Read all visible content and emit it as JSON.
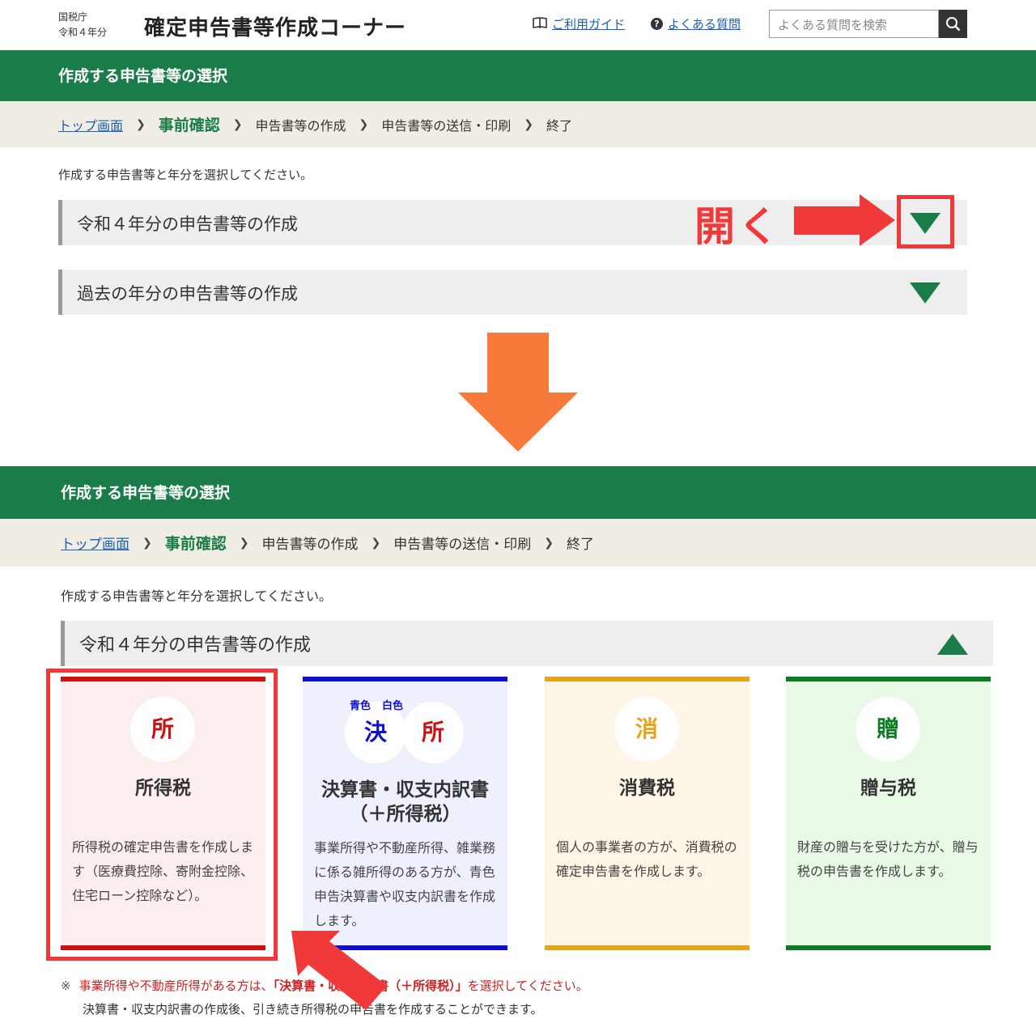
{
  "header": {
    "agency": "国税庁",
    "year": "令和４年分",
    "app_title": "確定申告書等作成コーナー",
    "guide_link": "ご利用ガイド",
    "faq_link": "よくある質問",
    "search_placeholder": "よくある質問を検索"
  },
  "top": {
    "page_title": "作成する申告書等の選択",
    "breadcrumb": [
      "トップ画面",
      "事前確認",
      "申告書等の作成",
      "申告書等の送信・印刷",
      "終了"
    ],
    "instruction": "作成する申告書等と年分を選択してください。",
    "accordion_current": "令和４年分の申告書等の作成",
    "accordion_past": "過去の年分の申告書等の作成",
    "annotation": "開く"
  },
  "bottom": {
    "page_title": "作成する申告書等の選択",
    "breadcrumb": [
      "トップ画面",
      "事前確認",
      "申告書等の作成",
      "申告書等の送信・印刷",
      "終了"
    ],
    "instruction": "作成する申告書等と年分を選択してください。",
    "accordion_current": "令和４年分の申告書等の作成",
    "cards": [
      {
        "icon_char": "所",
        "title": "所得税",
        "desc": "所得税の確定申告書を作成します（医療費控除、寄附金控除、住宅ローン控除など）。"
      },
      {
        "icon_char_1": "決",
        "icon_char_2": "所",
        "tag_blue": "青色",
        "tag_white": "白色",
        "title_1": "決算書・収支内訳書",
        "title_2": "（＋所得税）",
        "desc": "事業所得や不動産所得、雑業務に係る雑所得のある方が、青色申告決算書や収支内訳書を作成します。"
      },
      {
        "icon_char": "消",
        "title": "消費税",
        "desc": "個人の事業者の方が、消費税の確定申告書を作成します。"
      },
      {
        "icon_char": "贈",
        "title": "贈与税",
        "desc": "財産の贈与を受けた方が、贈与税の申告書を作成します。"
      }
    ],
    "note_mark": "※",
    "note_pre": "事業所得や不動産所得がある方は、",
    "note_em": "「決算書・収支内訳書（＋所得税）」",
    "note_post": "を選択してください。",
    "note_2": "決算書・収支内訳書の作成後、引き続き所得税の申告書を作成することができます。"
  },
  "colors": {
    "brand_green": "#1a7d49",
    "annotation_red": "#f03a3a",
    "annotation_orange": "#f77a3a"
  }
}
